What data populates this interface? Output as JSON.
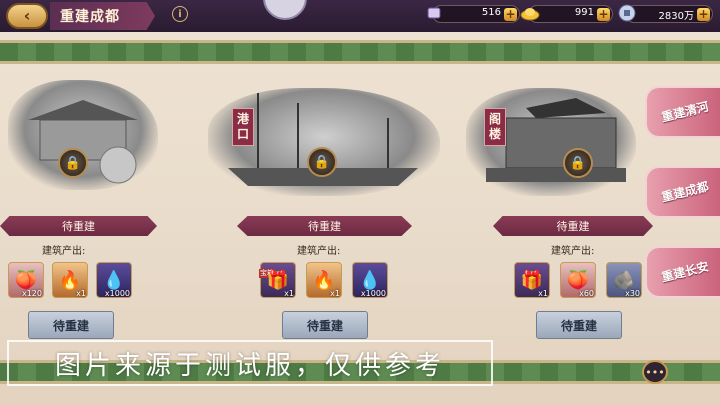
{
  "header": {
    "title": "重建成都",
    "back_icon": "‹",
    "info_icon": "i",
    "resources": [
      {
        "icon": "scroll",
        "value": "516"
      },
      {
        "icon": "gold-ingot",
        "value": "991"
      },
      {
        "icon": "coin",
        "value": "2830万"
      }
    ],
    "plus": "+"
  },
  "buildings": [
    {
      "tag": "",
      "status": "待重建",
      "output_label": "建筑产出:",
      "items": [
        {
          "icon": "peach",
          "count": "x120",
          "badge": ""
        },
        {
          "icon": "flame-orb",
          "count": "x1",
          "badge": ""
        },
        {
          "icon": "blue-crystal",
          "count": "x1000",
          "badge": ""
        }
      ],
      "button": "待重建"
    },
    {
      "tag": "港口",
      "status": "待重建",
      "output_label": "建筑产出:",
      "items": [
        {
          "icon": "gold-box",
          "count": "x1",
          "badge": "宝箱"
        },
        {
          "icon": "flame-orb",
          "count": "x1",
          "badge": ""
        },
        {
          "icon": "blue-crystal",
          "count": "x1000",
          "badge": ""
        }
      ],
      "button": "待重建"
    },
    {
      "tag": "阁楼",
      "status": "待重建",
      "output_label": "建筑产出:",
      "items": [
        {
          "icon": "gold-box",
          "count": "x1",
          "badge": ""
        },
        {
          "icon": "peach",
          "count": "x60",
          "badge": ""
        },
        {
          "icon": "blue-stone",
          "count": "x30",
          "badge": ""
        }
      ],
      "button": "待重建"
    }
  ],
  "side_tabs": [
    "重建清河",
    "重建成都",
    "重建长安"
  ],
  "watermark": "图片来源于测试服，仅供参考",
  "chat_icon": "•••"
}
